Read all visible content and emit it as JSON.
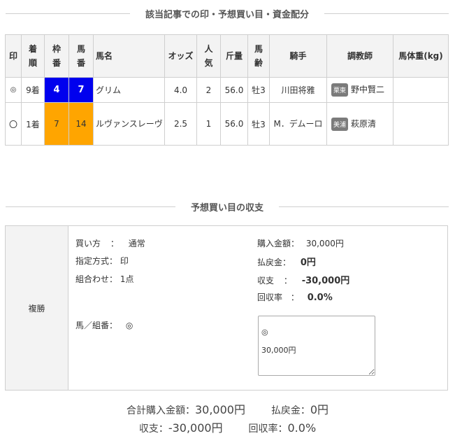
{
  "heading1": "該当記事での印・予想買い目・資金配分",
  "heading2": "予想買い目の収支",
  "table": {
    "headers": {
      "mark": "印",
      "rank": "着順",
      "waku": "枠番",
      "umaban": "馬番",
      "name": "馬名",
      "odds": "オッズ",
      "popularity": "人気",
      "weight": "斤量",
      "sexage": "馬齢",
      "jockey": "騎手",
      "trainer": "調教師",
      "bodyweight": "馬体重(kg)"
    },
    "rows": [
      {
        "mark": "◎",
        "rank": "9着",
        "waku": "4",
        "umaban": "7",
        "name": "グリム",
        "odds": "4.0",
        "popularity": "2",
        "weight": "56.0",
        "sexage": "牡3",
        "jockey": "川田将雅",
        "stable": "栗東",
        "trainer": "野中賢二",
        "bodyweight": "",
        "waku_color": "#0000ee"
      },
      {
        "mark": "〇",
        "rank": "1着",
        "waku": "7",
        "umaban": "14",
        "name": "ルヴァンスレーヴ",
        "odds": "2.5",
        "popularity": "1",
        "weight": "56.0",
        "sexage": "牡3",
        "jockey": "M．デムーロ",
        "stable": "美浦",
        "trainer": "萩原清",
        "bodyweight": "",
        "waku_color": "#ffa500"
      }
    ]
  },
  "bet": {
    "type": "複勝",
    "method_label": "買い方",
    "method_value": "通常",
    "spec_label": "指定方式：",
    "spec_value": "印",
    "combo_label": "組合わせ：",
    "combo_value": "1点",
    "horse_label": "馬／組番：",
    "horse_value": "◎",
    "purchase_label": "購入金額：",
    "purchase_value": "30,000円",
    "refund_label": "払戻金：",
    "refund_value": "0円",
    "balance_label": "収支",
    "balance_value": "-30,000円",
    "recovery_label": "回収率",
    "recovery_value": "0.0%",
    "textarea_value": "◎\n30,000円"
  },
  "totals": {
    "total_purchase_label": "合計購入金額：",
    "total_purchase_value": "30,000円",
    "refund_label": "払戻金：",
    "refund_value": "0円",
    "balance_label": "収支：",
    "balance_value": "-30,000円",
    "recovery_label": "回収率：",
    "recovery_value": "0.0%"
  }
}
